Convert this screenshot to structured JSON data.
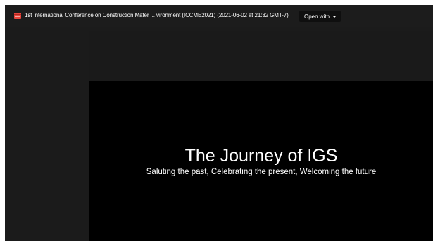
{
  "header": {
    "file_icon": "presentation-file-icon",
    "file_title": "1st International Conference on Construction Mater ... vironment (ICCME2021) (2021-06-02 at 21:32 GMT-7)",
    "open_with_label": "Open with",
    "open_with_icon": "chevron-down-icon"
  },
  "slide": {
    "title": "The Journey of IGS",
    "subtitle": "Saluting the past, Celebrating the present, Welcoming the future"
  },
  "colors": {
    "file_icon": "#e8453c",
    "background": "#1b1b1b",
    "slide_background": "#000000"
  }
}
